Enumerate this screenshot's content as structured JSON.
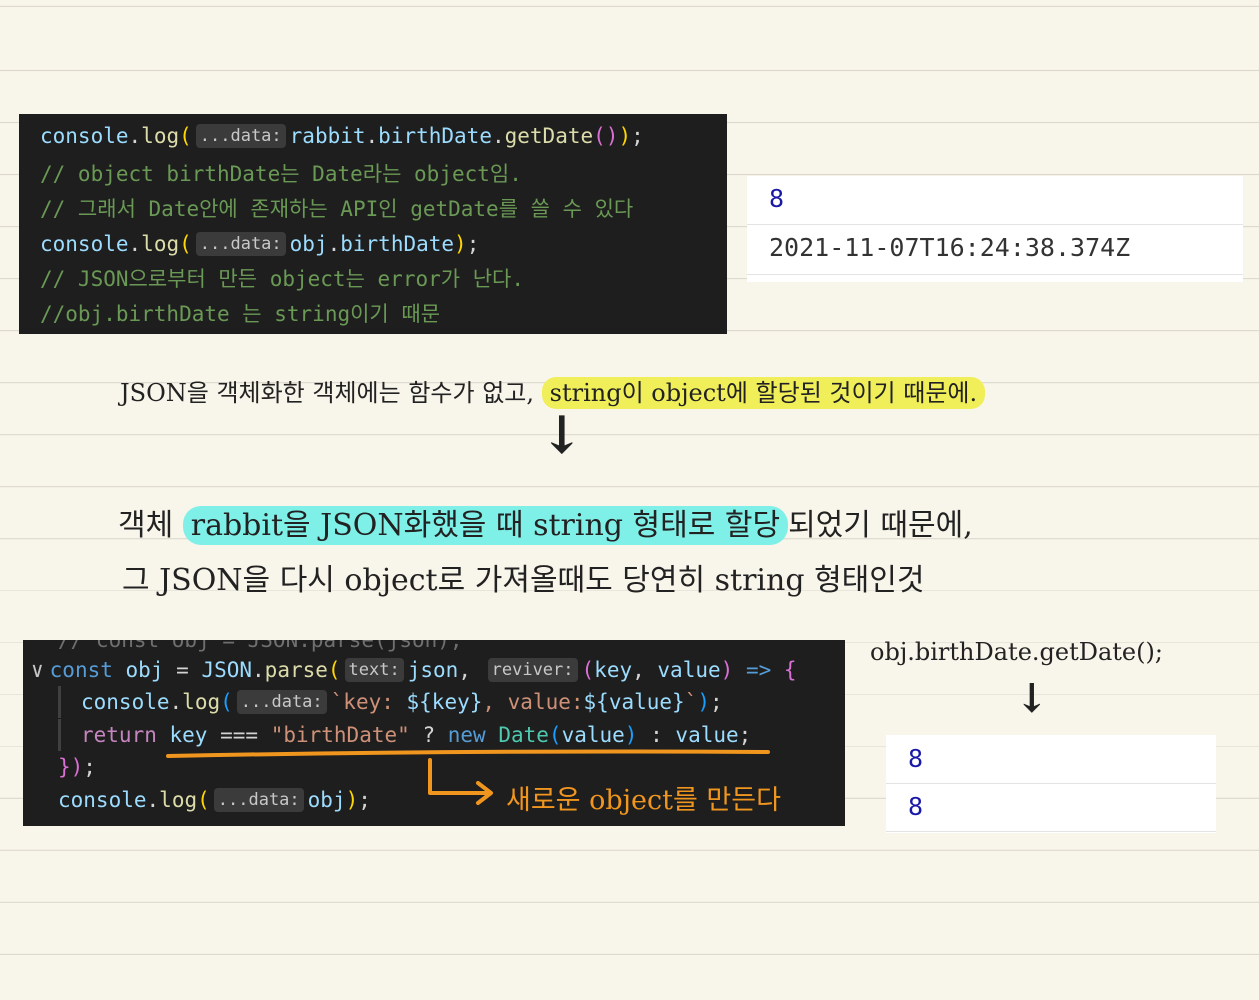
{
  "code_block_1": {
    "line1": {
      "obj": "console",
      "dot": ".",
      "method": "log",
      "open": "(",
      "hint": "...data:",
      "arg_obj": "rabbit",
      "arg_prop": "birthDate",
      "arg_call": "getDate",
      "inner_parens": "()",
      "close": ")",
      "semi": ";"
    },
    "line2": "// object birthDate는 Date라는 object임.",
    "line3": "// 그래서 Date안에 존재하는 API인 getDate를 쓸 수 있다",
    "line4": {
      "obj": "console",
      "dot": ".",
      "method": "log",
      "open": "(",
      "hint": "...data:",
      "arg_obj": "obj",
      "arg_prop": "birthDate",
      "close": ")",
      "semi": ";"
    },
    "line5": "// JSON으로부터 만든 object는 error가 난다.",
    "line6": "//obj.birthDate 는 string이기 때문"
  },
  "output_1": {
    "row1": "8",
    "row2": "2021-11-07T16:24:38.374Z"
  },
  "note_1": {
    "plain": "JSON을 객체화한 객체에는 함수가 없고, ",
    "highlighted": "string이 object에 할당된 것이기 때문에."
  },
  "arrow_1": "↓",
  "note_2": {
    "prefix": "객체 ",
    "highlighted": "rabbit을 JSON화했을 때 string 형태로 할당",
    "suffix": "되었기 때문에,"
  },
  "note_3": "그 JSON을 다시 object로 가져올때도 당연히 string 형태인것",
  "code_block_2": {
    "line0": "// const obj = JSON.parse(json);",
    "line1": {
      "fold": "∨",
      "kw": "const",
      "name": "obj",
      "eq": "=",
      "obj": "JSON",
      "method": "parse",
      "open": "(",
      "hint1": "text:",
      "arg1": "json",
      "comma": ",",
      "hint2": "reviver:",
      "params_open": "(",
      "p1": "key",
      "p2": "value",
      "params_close": ")",
      "arrow": "=>",
      "brace": "{"
    },
    "line2": {
      "obj": "console",
      "method": "log",
      "open": "(",
      "hint": "...data:",
      "tpl_start": "`key: ",
      "interp1": "${key}",
      "tpl_mid": ", value:",
      "interp2": "${value}",
      "tpl_end": "`",
      "close": ")",
      "semi": ";"
    },
    "line3": {
      "kw": "return",
      "key": "key",
      "op": "===",
      "str": "\"birthDate\"",
      "q": "?",
      "new": "new",
      "cls": "Date",
      "open": "(",
      "arg": "value",
      "close": ")",
      "colon": ":",
      "val": "value",
      "semi": ";"
    },
    "line4": {
      "close": "})",
      "semi": ";"
    },
    "line5": {
      "obj": "console",
      "method": "log",
      "open": "(",
      "hint": "...data:",
      "arg": "obj",
      "close": ")",
      "semi": ";"
    }
  },
  "annotation_orange": "새로운 object를 만든다",
  "note_4": "obj.birthDate.getDate();",
  "arrow_2": "↓",
  "output_2": {
    "row1": "8",
    "row2": "8"
  },
  "colors": {
    "highlight_yellow": "#f0ef5a",
    "highlight_cyan": "#7ff0e8",
    "annotation_orange": "#f0961e"
  }
}
